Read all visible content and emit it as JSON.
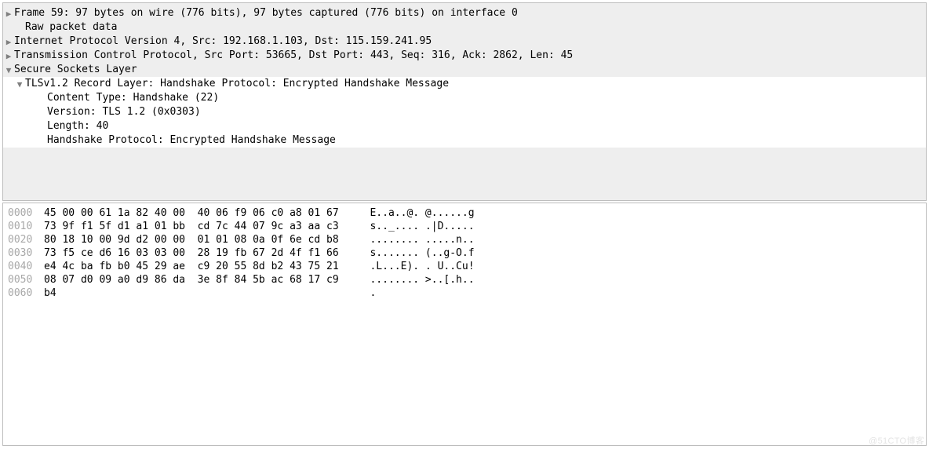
{
  "tree": {
    "frame": "Frame 59: 97 bytes on wire (776 bits), 97 bytes captured (776 bits) on interface 0",
    "raw": "Raw packet data",
    "ip": "Internet Protocol Version 4, Src: 192.168.1.103, Dst: 115.159.241.95",
    "tcp": "Transmission Control Protocol, Src Port: 53665, Dst Port: 443, Seq: 316, Ack: 2862, Len: 45",
    "ssl_header": "Secure Sockets Layer",
    "tls_record": "TLSv1.2 Record Layer: Handshake Protocol: Encrypted Handshake Message",
    "content_type": "Content Type: Handshake (22)",
    "version": "Version: TLS 1.2 (0x0303)",
    "length": "Length: 40",
    "handshake_proto": "Handshake Protocol: Encrypted Handshake Message"
  },
  "hex": [
    {
      "offset": "0000",
      "bytes": "45 00 00 61 1a 82 40 00  40 06 f9 06 c0 a8 01 67",
      "ascii": "E..a..@. @......g"
    },
    {
      "offset": "0010",
      "bytes": "73 9f f1 5f d1 a1 01 bb  cd 7c 44 07 9c a3 aa c3",
      "ascii": "s.._.... .|D....."
    },
    {
      "offset": "0020",
      "bytes": "80 18 10 00 9d d2 00 00  01 01 08 0a 0f 6e cd b8",
      "ascii": "........ .....n.."
    },
    {
      "offset": "0030",
      "bytes": "73 f5 ce d6 16 03 03 00  28 19 fb 67 2d 4f f1 66",
      "ascii": "s....... (..g-O.f"
    },
    {
      "offset": "0040",
      "bytes": "e4 4c ba fb b0 45 29 ae  c9 20 55 8d b2 43 75 21",
      "ascii": ".L...E). . U..Cu!"
    },
    {
      "offset": "0050",
      "bytes": "08 07 d0 09 a0 d9 86 da  3e 8f 84 5b ac 68 17 c9",
      "ascii": "........ >..[.h.."
    },
    {
      "offset": "0060",
      "bytes": "b4",
      "ascii": "."
    }
  ],
  "watermark": "@51CTO博客"
}
